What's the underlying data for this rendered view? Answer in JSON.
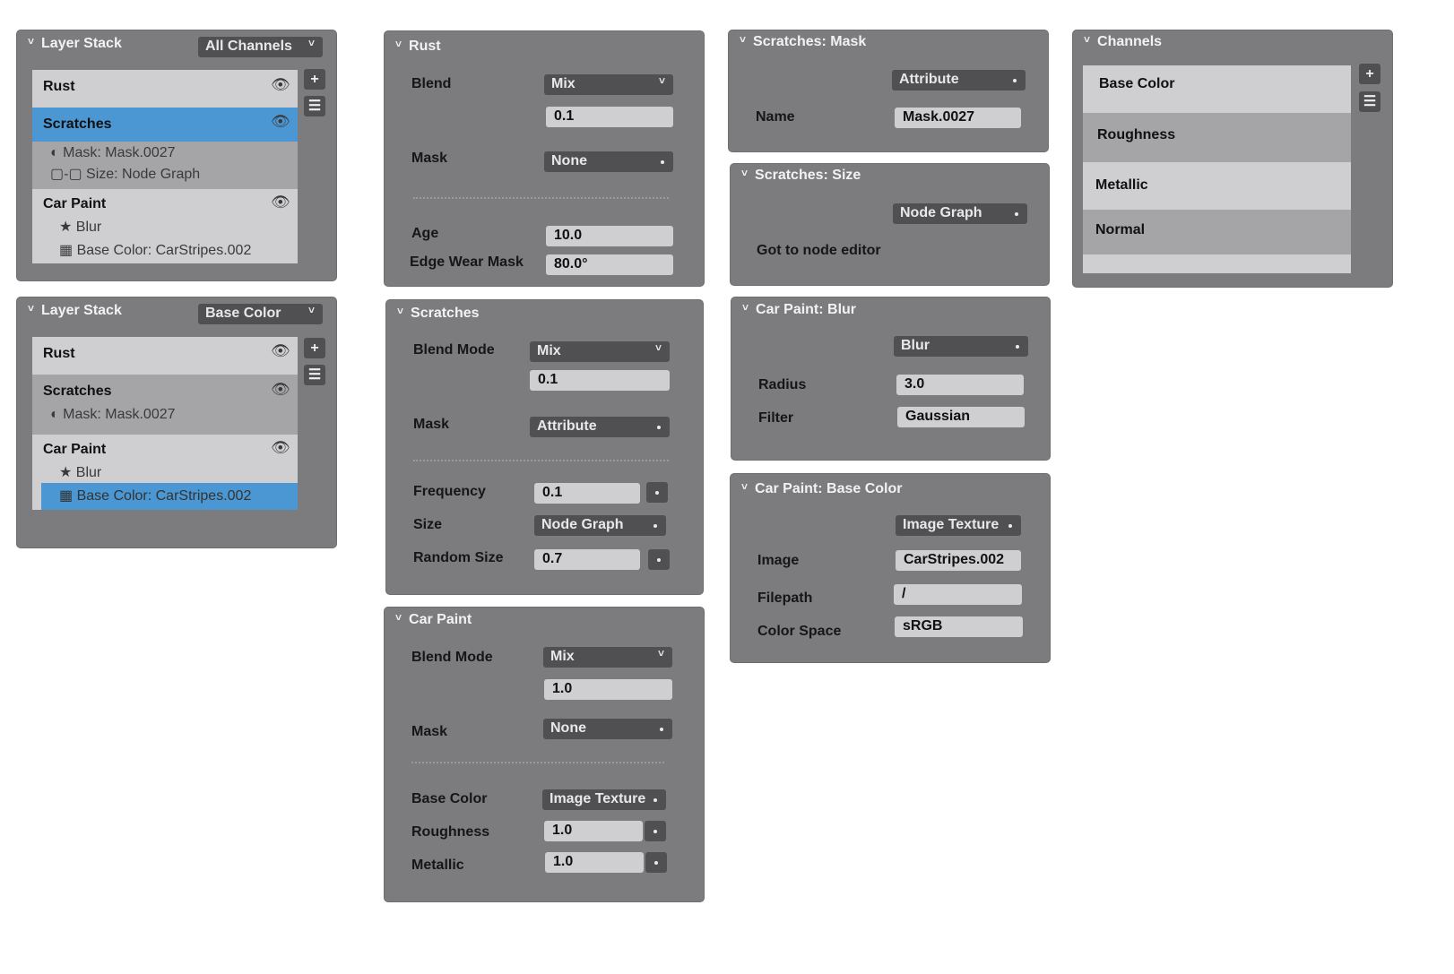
{
  "layer_stack_1": {
    "title": "Layer Stack",
    "channel_select": "All Channels",
    "layers": [
      {
        "name": "Rust"
      },
      {
        "name": "Scratches",
        "mask": "Mask: Mask.0027",
        "size": "Size: Node Graph"
      },
      {
        "name": "Car Paint",
        "effect": "Blur",
        "base_color": "Base Color: CarStripes.002"
      }
    ],
    "add_label": "+",
    "menu_label": "☰"
  },
  "layer_stack_2": {
    "title": "Layer Stack",
    "channel_select": "Base Color",
    "layers": [
      {
        "name": "Rust"
      },
      {
        "name": "Scratches",
        "mask": "Mask: Mask.0027"
      },
      {
        "name": "Car Paint",
        "effect": "Blur",
        "base_color": "Base Color: CarStripes.002"
      }
    ],
    "add_label": "+",
    "menu_label": "☰"
  },
  "rust": {
    "title": "Rust",
    "blend_label": "Blend",
    "blend_value": "Mix",
    "opacity": "0.1",
    "mask_label": "Mask",
    "mask_value": "None",
    "age_label": "Age",
    "age_value": "10.0",
    "edge_label": "Edge Wear Mask",
    "edge_value": "80.0°"
  },
  "scratches": {
    "title": "Scratches",
    "blend_label": "Blend Mode",
    "blend_value": "Mix",
    "opacity": "0.1",
    "mask_label": "Mask",
    "mask_value": "Attribute",
    "frequency_label": "Frequency",
    "frequency_value": "0.1",
    "size_label": "Size",
    "size_value": "Node Graph",
    "random_label": "Random Size",
    "random_value": "0.7"
  },
  "car_paint": {
    "title": "Car Paint",
    "blend_label": "Blend Mode",
    "blend_value": "Mix",
    "opacity": "1.0",
    "mask_label": "Mask",
    "mask_value": "None",
    "base_color_label": "Base Color",
    "base_color_value": "Image Texture",
    "roughness_label": "Roughness",
    "roughness_value": "1.0",
    "metallic_label": "Metallic",
    "metallic_value": "1.0"
  },
  "scratches_mask": {
    "title": "Scratches: Mask",
    "type_value": "Attribute",
    "name_label": "Name",
    "name_value": "Mask.0027"
  },
  "scratches_size": {
    "title": "Scratches: Size",
    "type_value": "Node Graph",
    "link_label": "Got to node editor"
  },
  "car_paint_blur": {
    "title": "Car Paint: Blur",
    "type_value": "Blur",
    "radius_label": "Radius",
    "radius_value": "3.0",
    "filter_label": "Filter",
    "filter_value": "Gaussian"
  },
  "car_paint_base_color": {
    "title": "Car Paint: Base Color",
    "type_value": "Image Texture",
    "image_label": "Image",
    "image_value": "CarStripes.002",
    "filepath_label": "Filepath",
    "filepath_value": "/",
    "colorspace_label": "Color Space",
    "colorspace_value": "sRGB"
  },
  "channels": {
    "title": "Channels",
    "items": [
      "Base Color",
      "Roughness",
      "Metallic",
      "Normal"
    ],
    "add_label": "+",
    "menu_label": "☰"
  },
  "colors": {
    "panel": "#7c7c7f",
    "selection": "#4a97d3",
    "list_light": "#cfcfd2",
    "list_dark": "#a5a5a8",
    "control_dark": "#505053"
  }
}
